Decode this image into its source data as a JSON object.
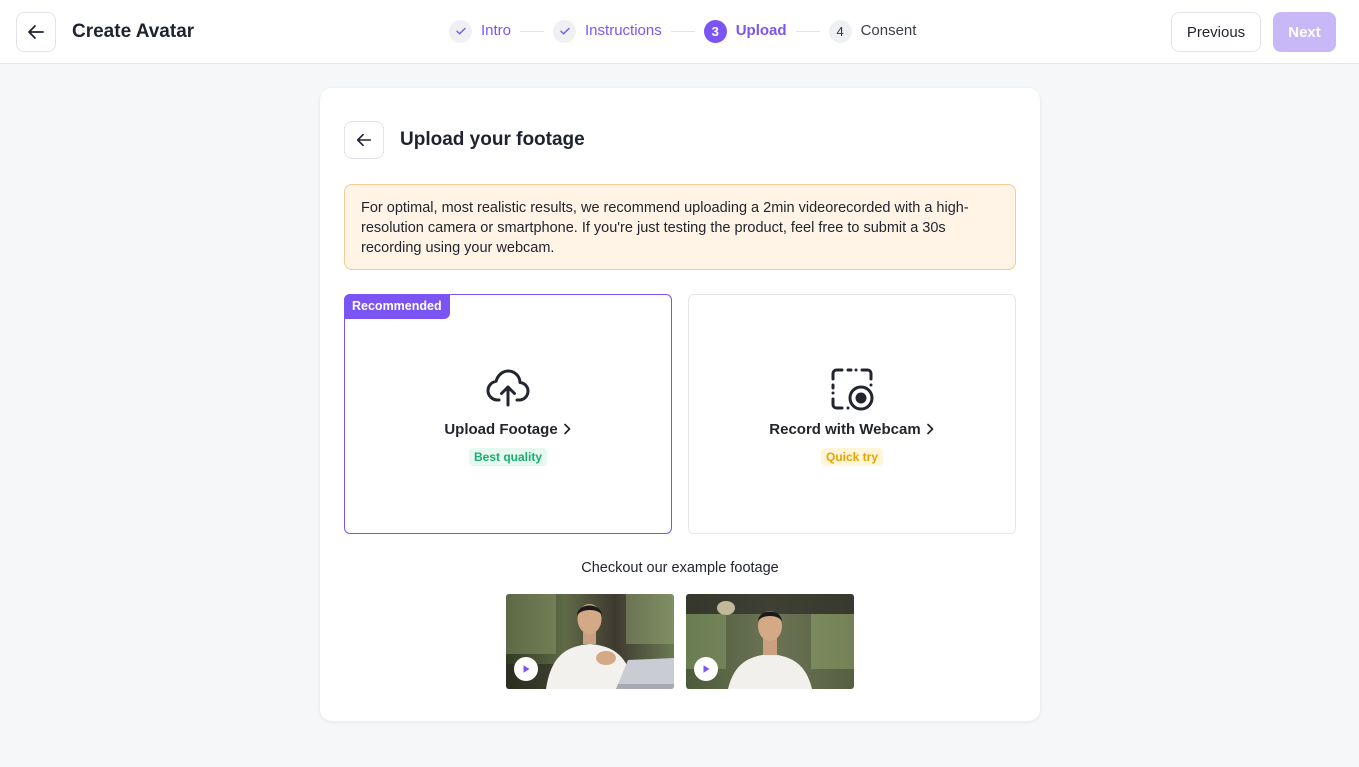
{
  "header": {
    "title": "Create Avatar",
    "steps": [
      {
        "number": "1",
        "label": "Intro",
        "state": "done"
      },
      {
        "number": "2",
        "label": "Instructions",
        "state": "done"
      },
      {
        "number": "3",
        "label": "Upload",
        "state": "active"
      },
      {
        "number": "4",
        "label": "Consent",
        "state": "todo"
      }
    ],
    "previous_label": "Previous",
    "next_label": "Next"
  },
  "card": {
    "title": "Upload your footage",
    "notice": "For optimal, most realistic results, we recommend uploading a 2min videorecorded with a high-resolution camera or smartphone. If you're just testing the product, feel free to submit a 30s recording using your webcam.",
    "options": [
      {
        "badge": "Recommended",
        "label": "Upload Footage",
        "tag": "Best quality",
        "icon": "cloud-upload-icon"
      },
      {
        "label": "Record with Webcam",
        "tag": "Quick try",
        "icon": "webcam-record-icon"
      }
    ],
    "examples_title": "Checkout our example footage"
  },
  "colors": {
    "accent": "#7b55f4",
    "accent_disabled": "#c8b8f7",
    "notice_bg": "#fff4e6",
    "notice_border": "#f3c995",
    "tag_green": "#1aae6f",
    "tag_yellow": "#e8a300"
  }
}
